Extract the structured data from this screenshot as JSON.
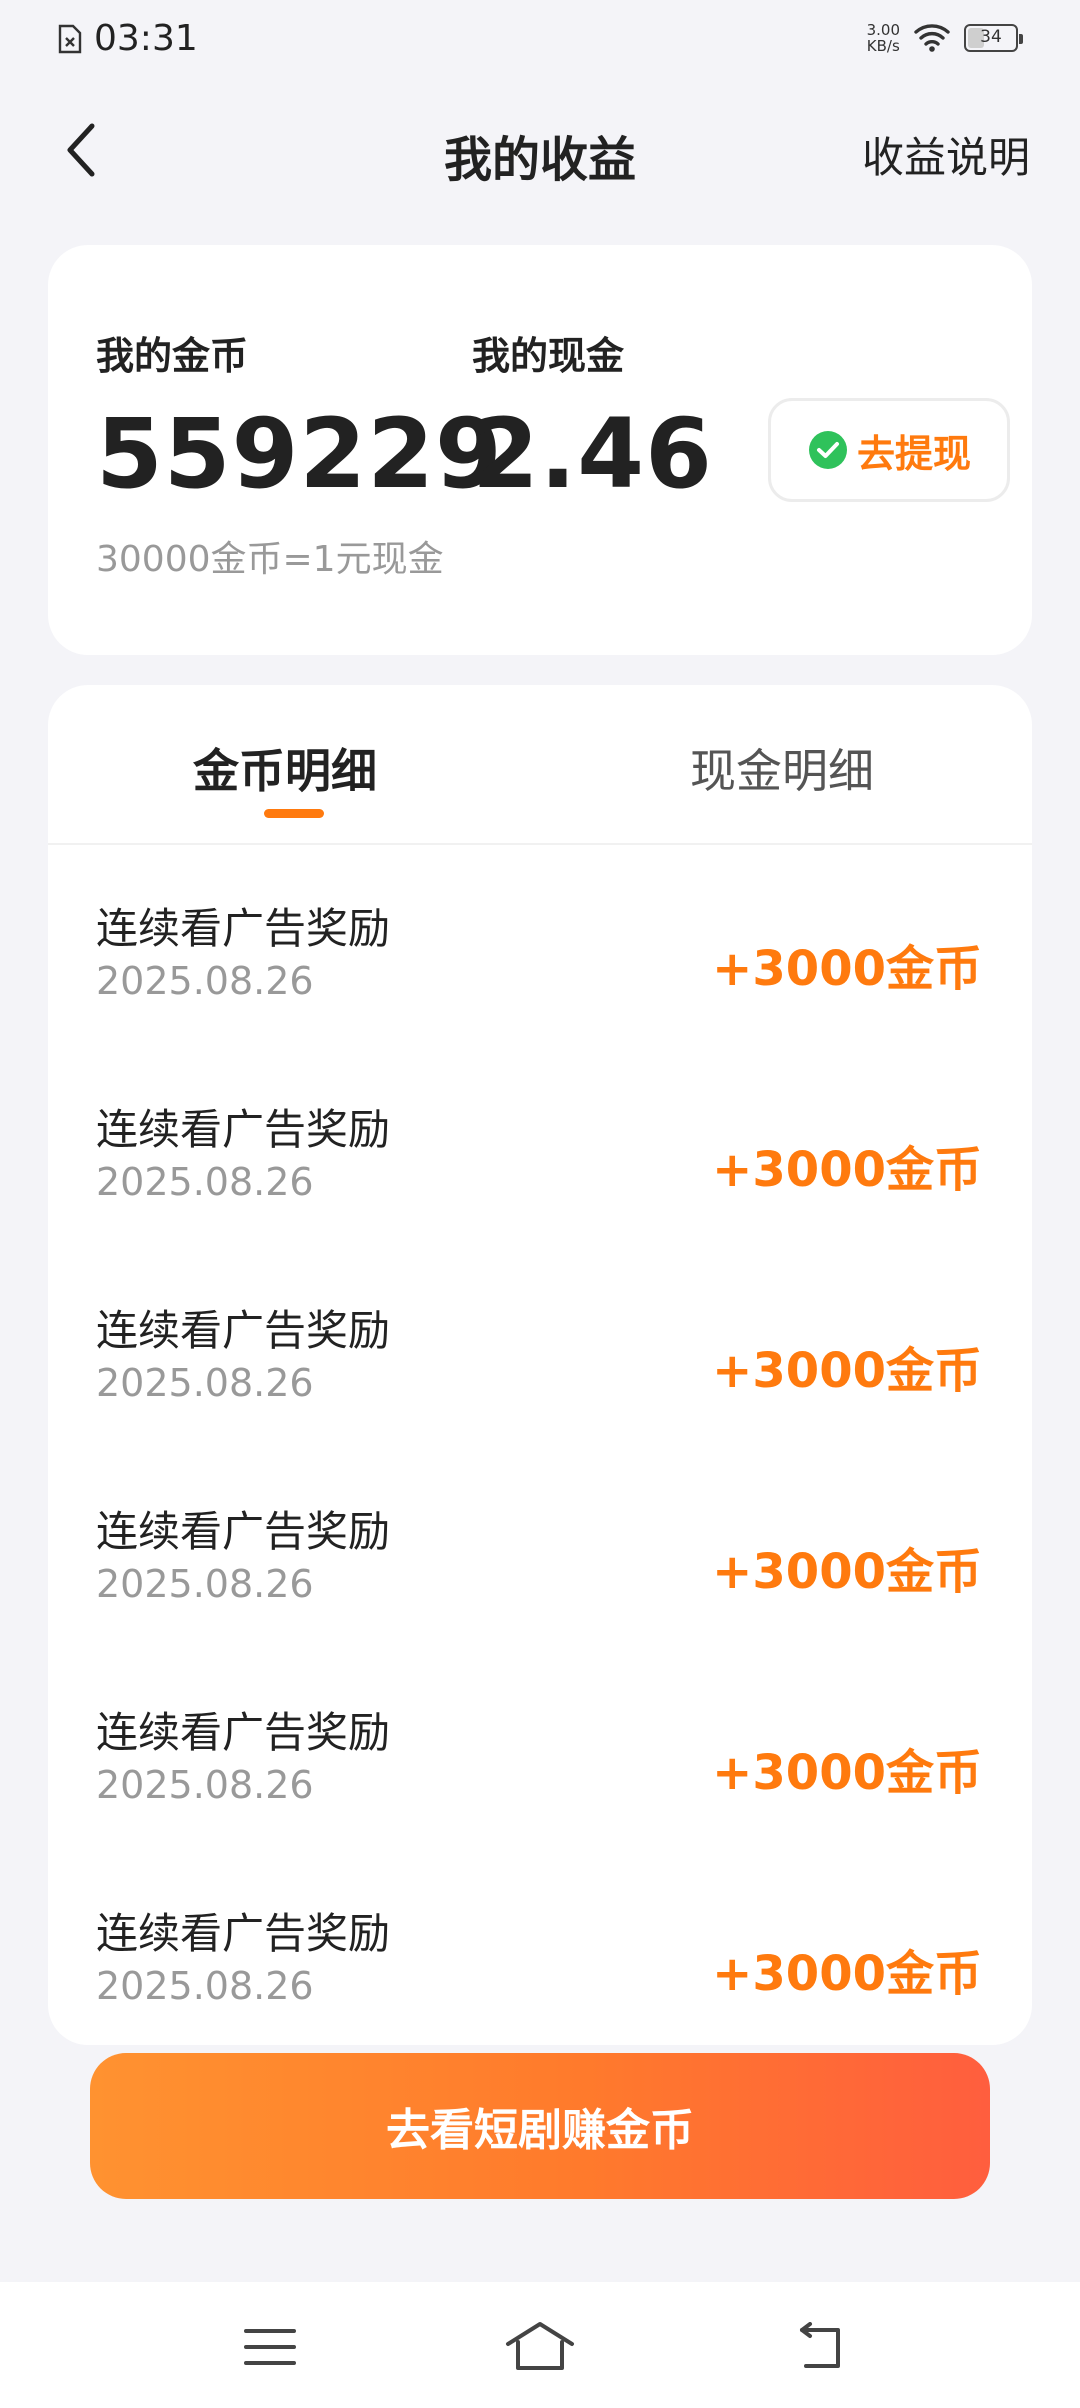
{
  "status_bar": {
    "time": "03:31",
    "speed_value": "3.00",
    "speed_unit": "KB/s",
    "battery": "34",
    "battery_level": 0.34
  },
  "header": {
    "title": "我的收益",
    "right_link": "收益说明"
  },
  "summary": {
    "coins_label": "我的金币",
    "coins_value": "559229",
    "cash_label": "我的现金",
    "cash_value": "2.46",
    "rate_text": "30000金币=1元现金",
    "withdraw_label": "去提现"
  },
  "tabs": [
    {
      "label": "金币明细",
      "active": true
    },
    {
      "label": "现金明细",
      "active": false
    }
  ],
  "records": [
    {
      "title": "连续看广告奖励",
      "date": "2025.08.26",
      "amount": "+3000金币"
    },
    {
      "title": "连续看广告奖励",
      "date": "2025.08.26",
      "amount": "+3000金币"
    },
    {
      "title": "连续看广告奖励",
      "date": "2025.08.26",
      "amount": "+3000金币"
    },
    {
      "title": "连续看广告奖励",
      "date": "2025.08.26",
      "amount": "+3000金币"
    },
    {
      "title": "连续看广告奖励",
      "date": "2025.08.26",
      "amount": "+3000金币"
    },
    {
      "title": "连续看广告奖励",
      "date": "2025.08.26",
      "amount": "+3000金币"
    }
  ],
  "cta": {
    "label": "去看短剧赚金币"
  },
  "colors": {
    "accent": "#ff7a0e",
    "background": "#f4f4f8",
    "wechat_green": "#2fc25b",
    "muted_text": "#999999"
  },
  "icons": {
    "back": "chevron-left-icon",
    "withdraw": "wechat-icon",
    "nav_menu": "menu-icon",
    "nav_home": "home-icon",
    "nav_back": "return-icon"
  }
}
